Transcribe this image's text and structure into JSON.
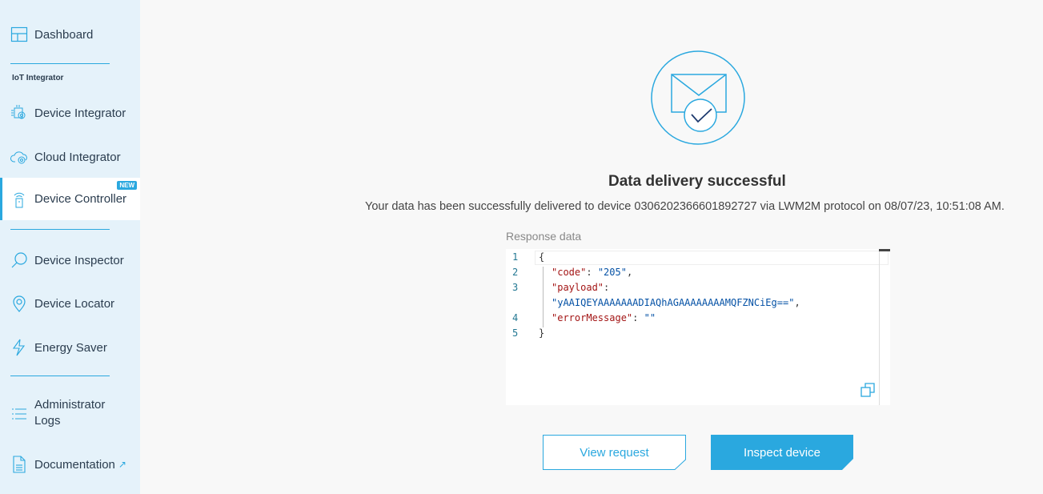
{
  "sidebar": {
    "items": [
      {
        "label": "Dashboard",
        "icon": "dashboard-icon"
      },
      {
        "label": "Device Integrator",
        "icon": "device-integrator-icon"
      },
      {
        "label": "Cloud Integrator",
        "icon": "cloud-integrator-icon"
      },
      {
        "label": "Device Controller",
        "icon": "device-controller-icon",
        "badge": "NEW",
        "active": true
      },
      {
        "label": "Device Inspector",
        "icon": "search-icon"
      },
      {
        "label": "Device Locator",
        "icon": "location-pin-icon"
      },
      {
        "label": "Energy Saver",
        "icon": "lightning-icon"
      },
      {
        "label": "Administrator Logs",
        "label_line1": "Administrator",
        "label_line2": "Logs",
        "icon": "list-icon"
      },
      {
        "label": "Documentation",
        "icon": "document-icon",
        "external": "↗"
      }
    ],
    "section_label": "IoT Integrator"
  },
  "main": {
    "icon": "mail-check-icon",
    "title": "Data delivery successful",
    "message": "Your data has been successfully delivered to device 0306202366601892727 via LWM2M protocol on 08/07/23, 10:51:08 AM.",
    "response_label": "Response data",
    "code": {
      "line_numbers": [
        "1",
        "2",
        "3",
        "4",
        "5"
      ],
      "lines": {
        "open": "{",
        "code_key": "\"code\"",
        "code_value": "\"205\"",
        "payload_key": "\"payload\"",
        "payload_value": "\"yAAIQEYAAAAAAADIAQhAGAAAAAAAAMQFZNCiEg==\"",
        "error_key": "\"errorMessage\"",
        "error_value": "\"\"",
        "close": "}"
      }
    },
    "buttons": {
      "view_request": "View request",
      "inspect_device": "Inspect device"
    }
  },
  "colors": {
    "accent": "#2aa8df",
    "sidebar_bg": "#e5f2fa",
    "page_bg": "#f8f8f8"
  }
}
